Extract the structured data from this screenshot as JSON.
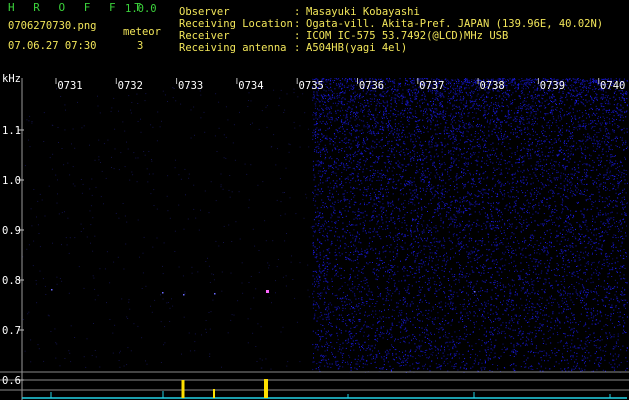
{
  "header": {
    "app_title": "H R O F F T",
    "version": "1.0.0",
    "filename": "0706270730.png",
    "meteor_label": "meteor",
    "datetime": "07.06.27 07:30",
    "meteor_count": "3"
  },
  "info": {
    "labels": [
      "Observer",
      "Receiving Location",
      "Receiver",
      "Receiving antenna"
    ],
    "colon": ":",
    "values": [
      "Masayuki Kobayashi",
      "Ogata-vill. Akita-Pref. JAPAN (139.96E, 40.02N)",
      "ICOM IC-575 53.7492(@LCD)MHz USB",
      "A504HB(yagi 4el)"
    ]
  },
  "axes": {
    "y_unit": "kHz",
    "y_ticks": [
      "1.1",
      "1.0",
      "0.9",
      "0.8",
      "0.7",
      "0.6"
    ],
    "x_ticks": [
      "0731",
      "0732",
      "0733",
      "0734",
      "0735",
      "0736",
      "0737",
      "0738",
      "0739",
      "0740"
    ]
  },
  "colors": {
    "background": "#000000",
    "noise": "#2a2ad6",
    "trace": "#22d3e6",
    "peak": "#ffe000",
    "green_text": "#3bd23b",
    "yellow_text": "#f2e65a"
  }
}
